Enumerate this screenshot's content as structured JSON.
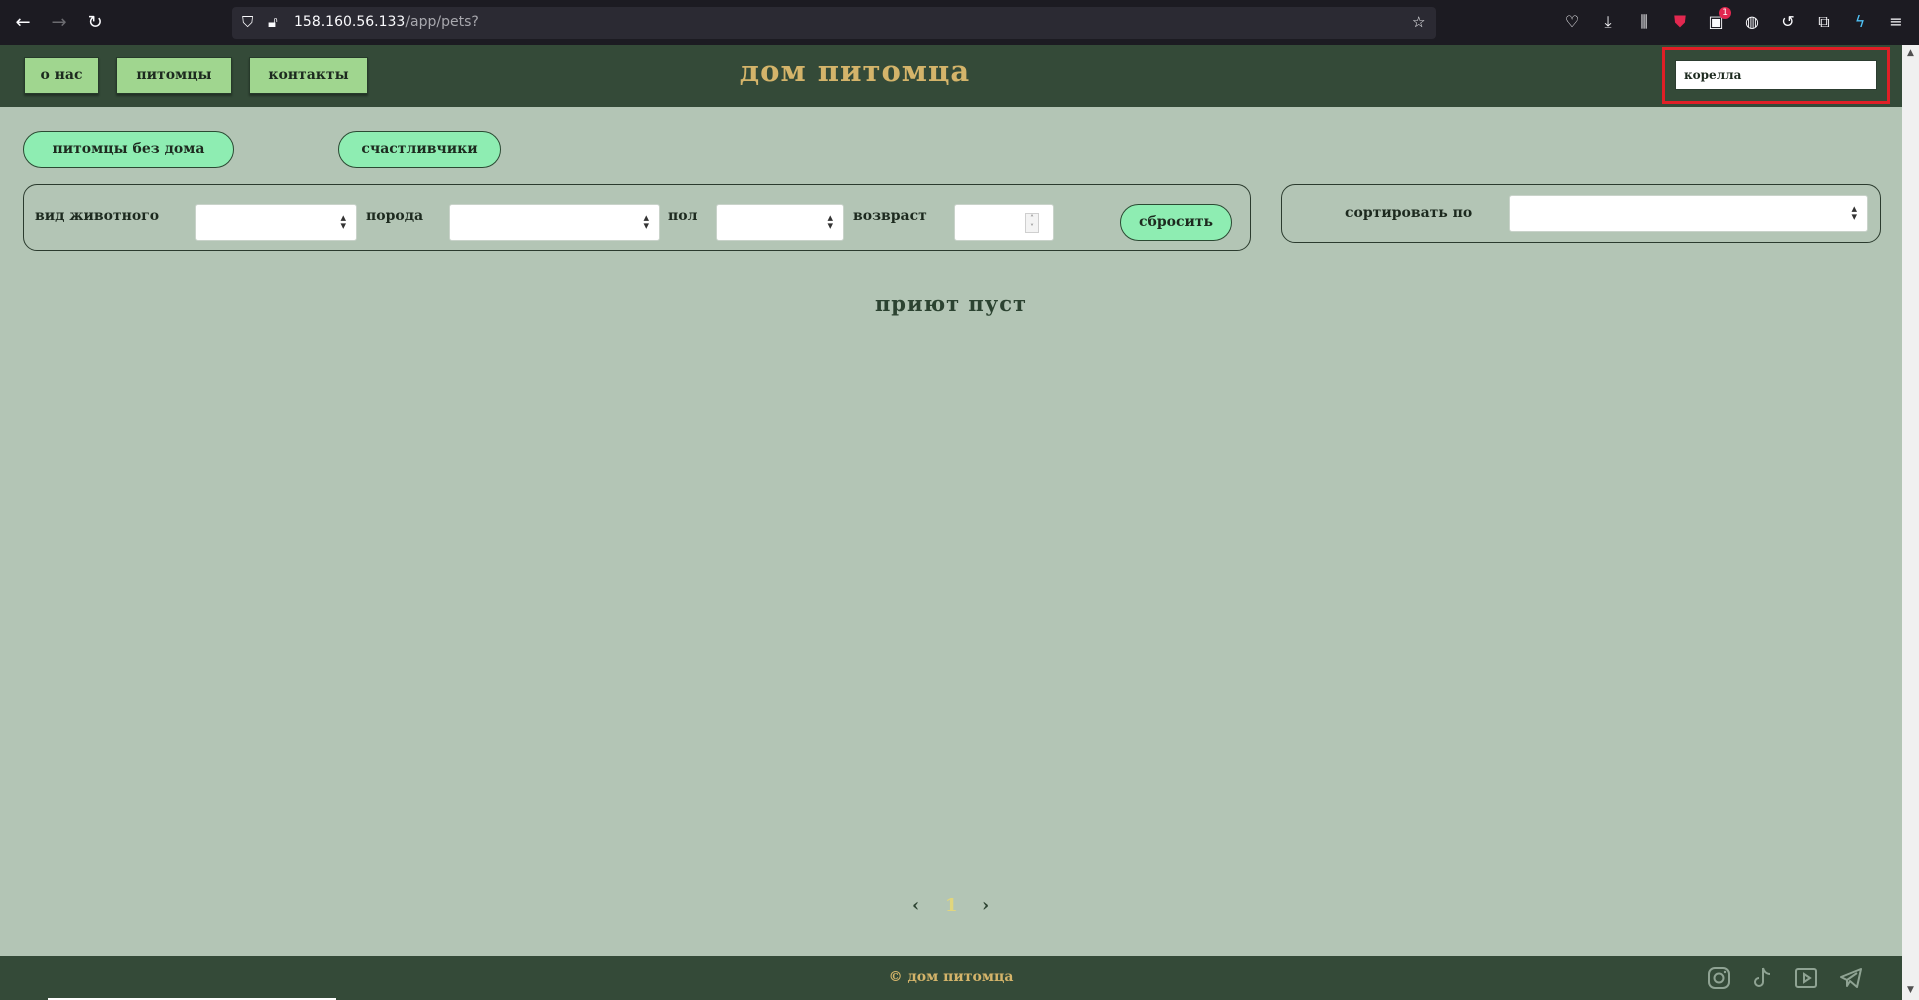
{
  "browser": {
    "url_host": "158.160.56.133",
    "url_path": "/app/pets?",
    "extension_badge": "1"
  },
  "header": {
    "nav": [
      {
        "label": "о нас"
      },
      {
        "label": "питомцы"
      },
      {
        "label": "контакты"
      }
    ],
    "title": "дом питомца",
    "search": {
      "value": "корелла"
    }
  },
  "categories": [
    {
      "label": "питомцы без дома"
    },
    {
      "label": "счастливчики"
    }
  ],
  "filters": {
    "animal_type_label": "вид животного",
    "breed_label": "порода",
    "sex_label": "пол",
    "age_label": "возвраст",
    "animal_type_value": "",
    "breed_value": "",
    "sex_value": "",
    "age_value": "",
    "reset_label": "сбросить"
  },
  "sort": {
    "label": "сортировать по",
    "value": ""
  },
  "empty_message": "приют пуст",
  "pagination": {
    "prev": "‹",
    "current": "1",
    "next": "›"
  },
  "footer": {
    "copyright": "© дом питомца",
    "socials": [
      "instagram-icon",
      "tiktok-icon",
      "youtube-icon",
      "telegram-icon"
    ]
  },
  "colors": {
    "header_bg": "#344a38",
    "page_bg": "#b3c5b5",
    "title_gold": "#d4b46a",
    "nav_green": "#a0d68f",
    "pill_mint": "#8eedb2",
    "highlight_red": "#e01f26"
  }
}
